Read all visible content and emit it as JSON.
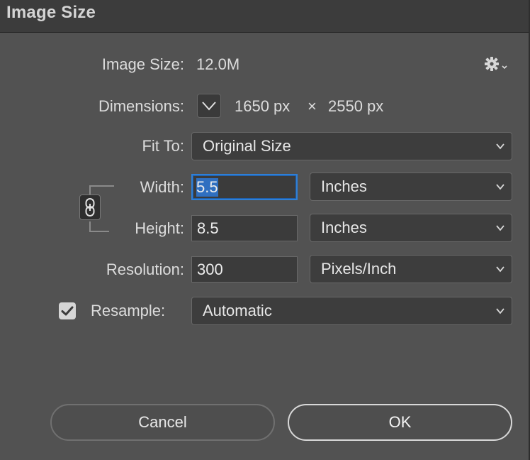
{
  "window": {
    "title": "Image Size"
  },
  "image_size": {
    "label": "Image Size:",
    "value": "12.0M",
    "settings_icon": "gear-icon"
  },
  "dimensions": {
    "label": "Dimensions:",
    "toggle_icon": "chevron-down-icon",
    "width": "1650 px",
    "times": "×",
    "height": "2550 px"
  },
  "fit_to": {
    "label": "Fit To:",
    "selected": "Original Size"
  },
  "width": {
    "label": "Width:",
    "value": "5.5",
    "unit": "Inches"
  },
  "height": {
    "label": "Height:",
    "value": "8.5",
    "unit": "Inches"
  },
  "constrain": {
    "icon": "link-icon"
  },
  "resolution": {
    "label": "Resolution:",
    "value": "300",
    "unit": "Pixels/Inch"
  },
  "resample": {
    "label": "Resample:",
    "checked": true,
    "selected": "Automatic"
  },
  "buttons": {
    "cancel": "Cancel",
    "ok": "OK"
  },
  "colors": {
    "focus_ring": "#2f7fd6",
    "selection": "#2f6fc0",
    "panel": "#525252"
  }
}
